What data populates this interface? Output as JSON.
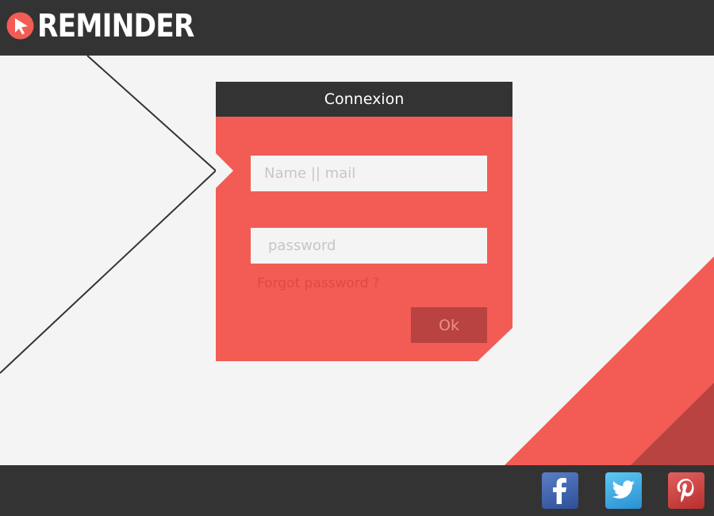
{
  "app": {
    "logo_text": "REMINDER",
    "logo_icon": "play-cursor-icon"
  },
  "login": {
    "title": "Connexion",
    "username_placeholder": "Name || mail",
    "password_placeholder": "password",
    "forgot_label": "Forgot password ?",
    "submit_label": "Ok"
  },
  "social": [
    {
      "name": "facebook-icon",
      "glyph": "f"
    },
    {
      "name": "twitter-icon",
      "glyph": "bird"
    },
    {
      "name": "pinterest-icon",
      "glyph": "P"
    }
  ],
  "colors": {
    "accent": "#f25c54",
    "dark": "#333333",
    "background": "#f4f4f4",
    "button": "#b94340"
  }
}
